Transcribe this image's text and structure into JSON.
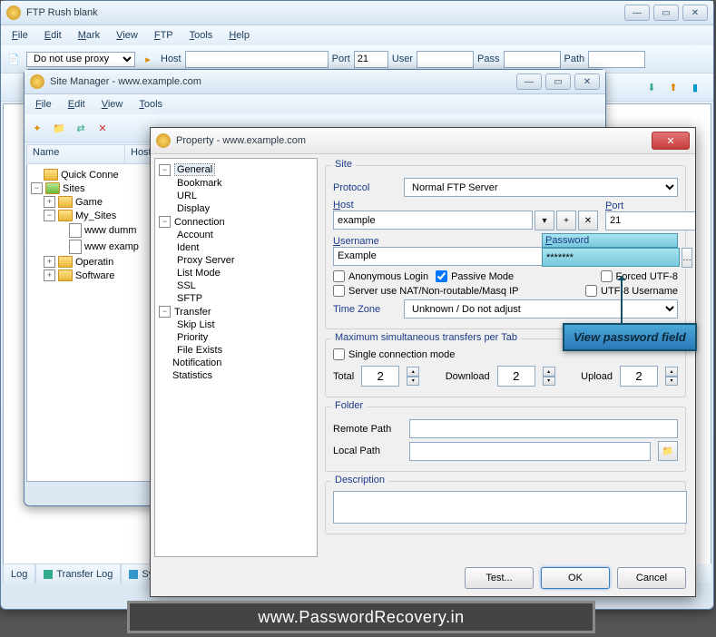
{
  "main": {
    "title": "FTP Rush  blank",
    "menu": [
      "File",
      "Edit",
      "Mark",
      "View",
      "FTP",
      "Tools",
      "Help"
    ],
    "proxy": "Do not use proxy",
    "hostlbl": "Host",
    "portlbl": "Port",
    "port": "21",
    "userlbl": "User",
    "passlbl": "Pass",
    "pathlbl": "Path"
  },
  "tabs": {
    "log": "Log",
    "transfer": "Transfer Log",
    "sys": "Syst"
  },
  "sm": {
    "title": "Site Manager  - www.example.com",
    "menu": [
      "File",
      "Edit",
      "View",
      "Tools"
    ],
    "cols": {
      "name": "Name",
      "host": "Host"
    },
    "tree": {
      "quick": "Quick Conne",
      "sites": "Sites",
      "game": "Game",
      "mysites": "My_Sites",
      "dummy": "www dumm",
      "example": "www examp",
      "operating": "Operatin",
      "software": "Software"
    }
  },
  "prop": {
    "title": "Property - www.example.com",
    "nav": {
      "general": "General",
      "bookmark": "Bookmark",
      "url": "URL",
      "display": "Display",
      "connection": "Connection",
      "account": "Account",
      "ident": "Ident",
      "proxy": "Proxy Server",
      "listmode": "List Mode",
      "ssl": "SSL",
      "sftp": "SFTP",
      "transfer": "Transfer",
      "skip": "Skip List",
      "priority": "Priority",
      "fileexists": "File Exists",
      "notification": "Notification",
      "statistics": "Statistics"
    },
    "site": {
      "lbl": "Site",
      "protocol_l": "Protocol",
      "protocol": "Normal FTP Server",
      "host_l": "Host",
      "host": "example",
      "port_l": "Port",
      "port": "21",
      "user_l": "Username",
      "user": "Example",
      "pass_l": "Password",
      "pass": "*******",
      "anon": "Anonymous Login",
      "passive": "Passive Mode",
      "utf8": "Forced UTF-8",
      "nat": "Server use NAT/Non-routable/Masq IP",
      "utf8u": "UTF-8 Username",
      "tz_l": "Time Zone",
      "tz": "Unknown / Do not adjust"
    },
    "max": {
      "lbl": "Maximum simultaneous transfers per Tab",
      "single": "Single connection mode",
      "total_l": "Total",
      "total": "2",
      "dl_l": "Download",
      "dl": "2",
      "ul_l": "Upload",
      "ul": "2"
    },
    "folder": {
      "lbl": "Folder",
      "remote": "Remote Path",
      "local": "Local Path"
    },
    "desc": {
      "lbl": "Description"
    },
    "btns": {
      "test": "Test...",
      "ok": "OK",
      "cancel": "Cancel"
    }
  },
  "callout": "View password field",
  "footer": "www.PasswordRecovery.in"
}
